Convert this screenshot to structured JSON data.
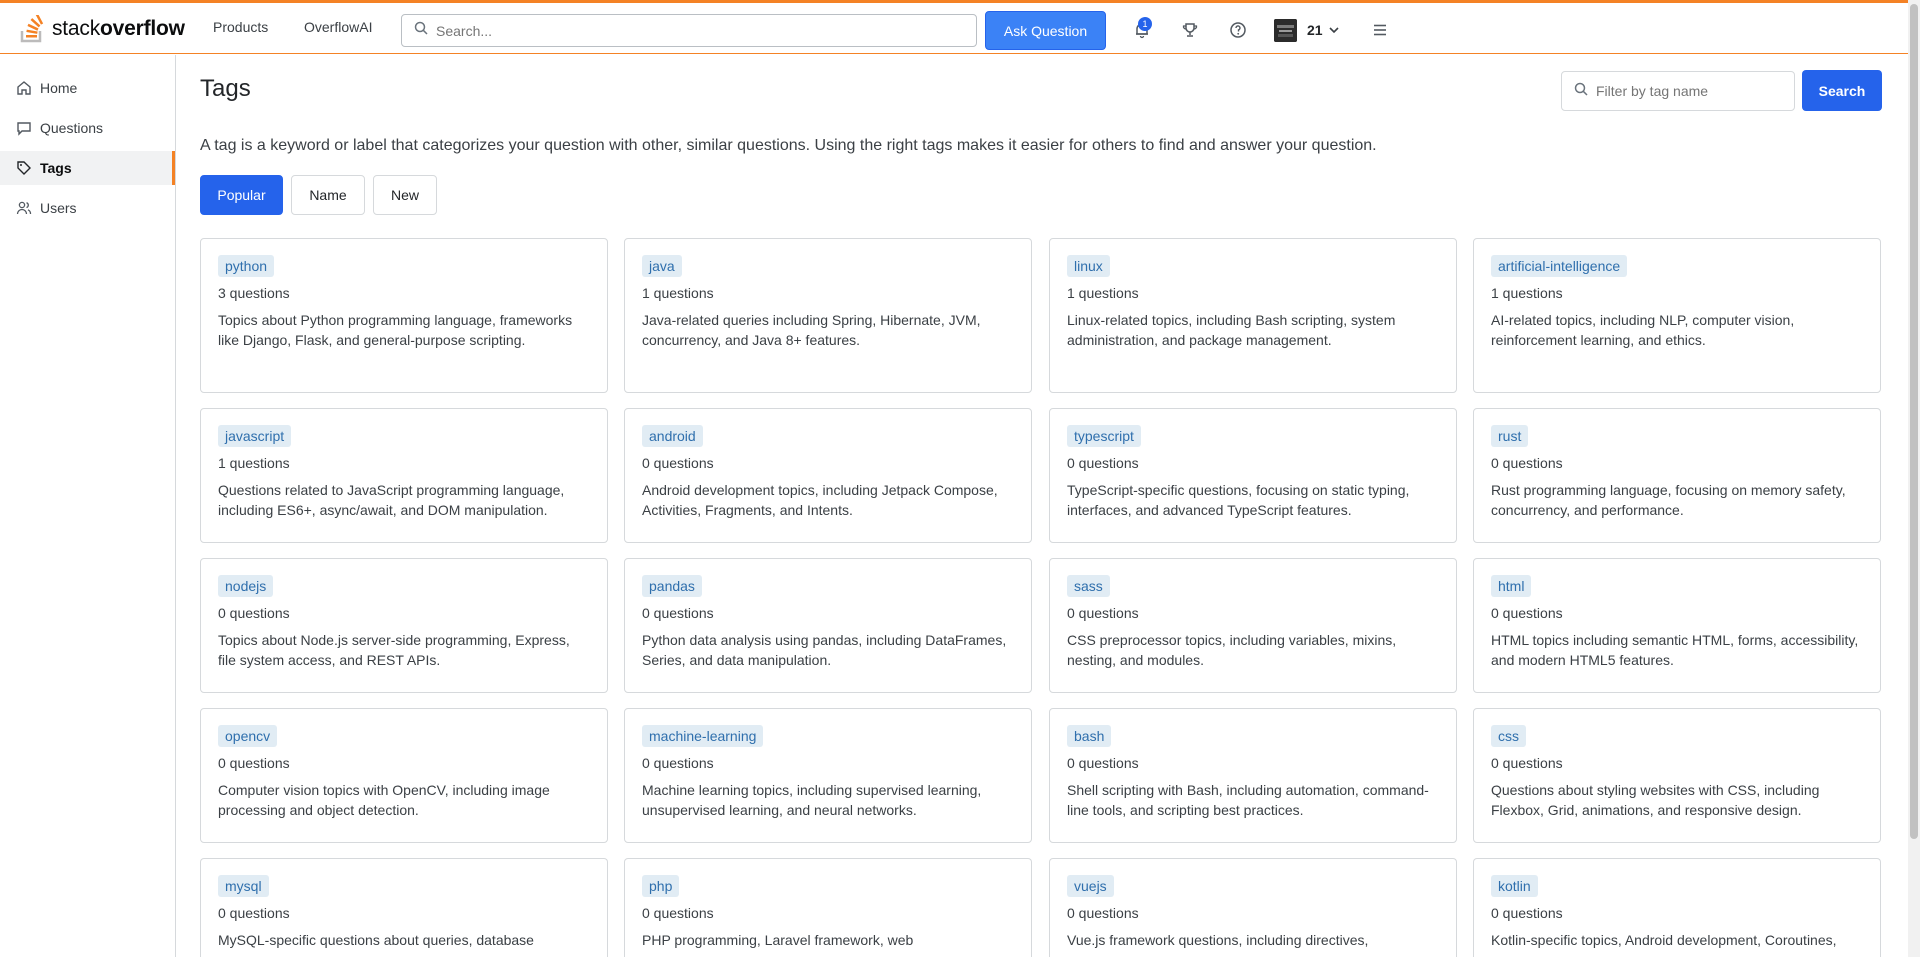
{
  "header": {
    "logo_light": "stack",
    "logo_bold": "overflow",
    "nav": [
      "Products",
      "OverflowAI"
    ],
    "search_placeholder": "Search...",
    "ask_button": "Ask Question",
    "notification_count": "1",
    "reputation": "21",
    "accent_color": "#f48225"
  },
  "sidebar": {
    "items": [
      {
        "label": "Home",
        "icon": "home-icon"
      },
      {
        "label": "Questions",
        "icon": "message-icon"
      },
      {
        "label": "Tags",
        "icon": "tag-icon"
      },
      {
        "label": "Users",
        "icon": "users-icon"
      }
    ],
    "active": "Tags"
  },
  "main": {
    "title": "Tags",
    "filter_placeholder": "Filter by tag name",
    "search_button": "Search",
    "intro": "A tag is a keyword or label that categorizes your question with other, similar questions. Using the right tags makes it easier for others to find and answer your question.",
    "tabs": [
      "Popular",
      "Name",
      "New"
    ],
    "active_tab": "Popular"
  },
  "tags": [
    {
      "name": "python",
      "count": "3 questions",
      "desc": "Topics about Python programming language, frameworks like Django, Flask, and general-purpose scripting."
    },
    {
      "name": "java",
      "count": "1 questions",
      "desc": "Java-related queries including Spring, Hibernate, JVM, concurrency, and Java 8+ features."
    },
    {
      "name": "linux",
      "count": "1 questions",
      "desc": "Linux-related topics, including Bash scripting, system administration, and package management."
    },
    {
      "name": "artificial-intelligence",
      "count": "1 questions",
      "desc": "AI-related topics, including NLP, computer vision, reinforcement learning, and ethics."
    },
    {
      "name": "javascript",
      "count": "1 questions",
      "desc": "Questions related to JavaScript programming language, including ES6+, async/await, and DOM manipulation."
    },
    {
      "name": "android",
      "count": "0 questions",
      "desc": "Android development topics, including Jetpack Compose, Activities, Fragments, and Intents."
    },
    {
      "name": "typescript",
      "count": "0 questions",
      "desc": "TypeScript-specific questions, focusing on static typing, interfaces, and advanced TypeScript features."
    },
    {
      "name": "rust",
      "count": "0 questions",
      "desc": "Rust programming language, focusing on memory safety, concurrency, and performance."
    },
    {
      "name": "nodejs",
      "count": "0 questions",
      "desc": "Topics about Node.js server-side programming, Express, file system access, and REST APIs."
    },
    {
      "name": "pandas",
      "count": "0 questions",
      "desc": "Python data analysis using pandas, including DataFrames, Series, and data manipulation."
    },
    {
      "name": "sass",
      "count": "0 questions",
      "desc": "CSS preprocessor topics, including variables, mixins, nesting, and modules."
    },
    {
      "name": "html",
      "count": "0 questions",
      "desc": "HTML topics including semantic HTML, forms, accessibility, and modern HTML5 features."
    },
    {
      "name": "opencv",
      "count": "0 questions",
      "desc": "Computer vision topics with OpenCV, including image processing and object detection."
    },
    {
      "name": "machine-learning",
      "count": "0 questions",
      "desc": "Machine learning topics, including supervised learning, unsupervised learning, and neural networks."
    },
    {
      "name": "bash",
      "count": "0 questions",
      "desc": "Shell scripting with Bash, including automation, command-line tools, and scripting best practices."
    },
    {
      "name": "css",
      "count": "0 questions",
      "desc": "Questions about styling websites with CSS, including Flexbox, Grid, animations, and responsive design."
    },
    {
      "name": "mysql",
      "count": "0 questions",
      "desc": "MySQL-specific questions about queries, database"
    },
    {
      "name": "php",
      "count": "0 questions",
      "desc": "PHP programming, Laravel framework, web"
    },
    {
      "name": "vuejs",
      "count": "0 questions",
      "desc": "Vue.js framework questions, including directives,"
    },
    {
      "name": "kotlin",
      "count": "0 questions",
      "desc": "Kotlin-specific topics, Android development, Coroutines,"
    }
  ]
}
